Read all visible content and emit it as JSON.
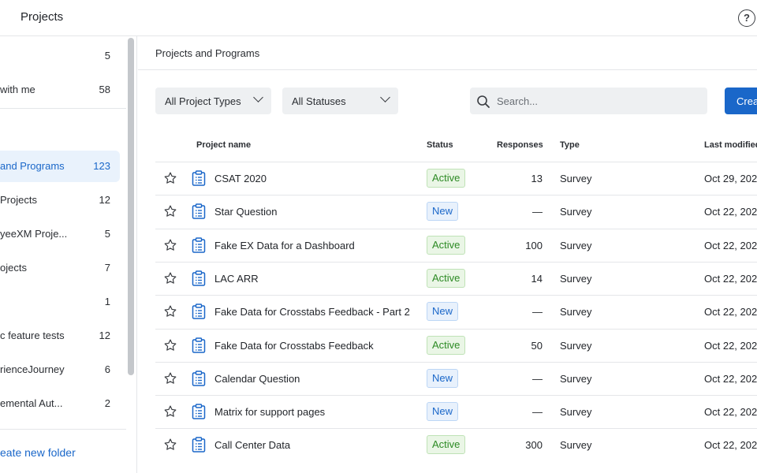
{
  "header": {
    "title": "Projects",
    "help_icon": "help-circle-icon",
    "help_glyph": "?"
  },
  "sidebar": {
    "items": [
      {
        "label": "",
        "count": "5"
      },
      {
        "label": "with me",
        "count": "58"
      },
      {
        "label": "and Programs",
        "count": "123",
        "active": true
      },
      {
        "label": "Projects",
        "count": "12"
      },
      {
        "label": "yeeXM Proje...",
        "count": "5"
      },
      {
        "label": "ojects",
        "count": "7"
      },
      {
        "label": "",
        "count": "1"
      },
      {
        "label": "c feature tests",
        "count": "12"
      },
      {
        "label": "rienceJourney",
        "count": "6"
      },
      {
        "label": "emental Aut...",
        "count": "2"
      }
    ],
    "new_folder_label": "eate new folder"
  },
  "main": {
    "section_title": "Projects and Programs",
    "filters": {
      "project_types": "All Project Types",
      "statuses": "All Statuses"
    },
    "search": {
      "placeholder": "Search...",
      "value": ""
    },
    "create_label": "Crea",
    "columns": {
      "name": "Project name",
      "status": "Status",
      "responses": "Responses",
      "type": "Type",
      "modified": "Last modified"
    },
    "rows": [
      {
        "name": "CSAT 2020",
        "status": "Active",
        "responses": "13",
        "type": "Survey",
        "modified": "Oct 29, 202"
      },
      {
        "name": "Star Question",
        "status": "New",
        "responses": "—",
        "type": "Survey",
        "modified": "Oct 22, 202"
      },
      {
        "name": "Fake EX Data for a Dashboard",
        "status": "Active",
        "responses": "100",
        "type": "Survey",
        "modified": "Oct 22, 202"
      },
      {
        "name": "LAC ARR",
        "status": "Active",
        "responses": "14",
        "type": "Survey",
        "modified": "Oct 22, 202"
      },
      {
        "name": "Fake Data for Crosstabs Feedback - Part 2",
        "status": "New",
        "responses": "—",
        "type": "Survey",
        "modified": "Oct 22, 202"
      },
      {
        "name": "Fake Data for Crosstabs Feedback",
        "status": "Active",
        "responses": "50",
        "type": "Survey",
        "modified": "Oct 22, 202"
      },
      {
        "name": "Calendar Question",
        "status": "New",
        "responses": "—",
        "type": "Survey",
        "modified": "Oct 22, 202"
      },
      {
        "name": "Matrix for support pages",
        "status": "New",
        "responses": "—",
        "type": "Survey",
        "modified": "Oct 22, 202"
      },
      {
        "name": "Call Center Data",
        "status": "Active",
        "responses": "300",
        "type": "Survey",
        "modified": "Oct 22, 202"
      }
    ]
  },
  "colors": {
    "accent": "#1a67c9",
    "active_green": "#2c8a24",
    "active_bg": "#eaf6e6",
    "new_blue": "#1a67c9",
    "new_bg": "#e8f1fc"
  },
  "icons": {
    "star": "star-outline-icon",
    "doc": "survey-clipboard-icon",
    "search": "search-icon",
    "chevron": "chevron-down-icon"
  }
}
